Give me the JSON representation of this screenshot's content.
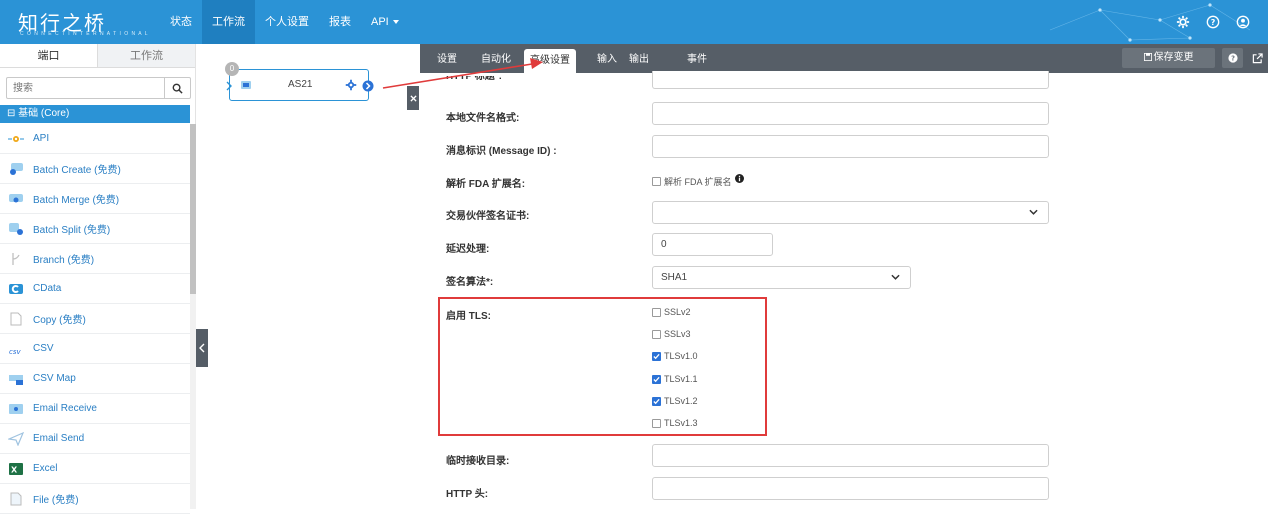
{
  "topbar": {
    "logo": "知行之桥",
    "logo_sub": "C O N N E C T   I N T E R N A T I O N A L",
    "nav": [
      {
        "label": "状态"
      },
      {
        "label": "工作流"
      },
      {
        "label": "个人设置"
      },
      {
        "label": "报表"
      },
      {
        "label": "API"
      }
    ],
    "icons": [
      "gear-icon",
      "help-icon",
      "user-icon"
    ]
  },
  "left": {
    "tabs": [
      {
        "label": "端口"
      },
      {
        "label": "工作流"
      }
    ],
    "search_placeholder": "搜索",
    "category": "⊟ 基础 (Core)",
    "items": [
      {
        "label": "API",
        "icon": "api-icon"
      },
      {
        "label": "Batch Create (免费)",
        "icon": "batch-create-icon"
      },
      {
        "label": "Batch Merge (免费)",
        "icon": "batch-merge-icon"
      },
      {
        "label": "Batch Split (免费)",
        "icon": "batch-split-icon"
      },
      {
        "label": "Branch (免费)",
        "icon": "branch-icon"
      },
      {
        "label": "CData",
        "icon": "cdata-icon"
      },
      {
        "label": "Copy (免费)",
        "icon": "copy-icon"
      },
      {
        "label": "CSV",
        "icon": "csv-icon"
      },
      {
        "label": "CSV Map",
        "icon": "csv-map-icon"
      },
      {
        "label": "Email Receive",
        "icon": "email-receive-icon"
      },
      {
        "label": "Email Send",
        "icon": "email-send-icon"
      },
      {
        "label": "Excel",
        "icon": "excel-icon"
      },
      {
        "label": "File (免费)",
        "icon": "file-icon"
      }
    ]
  },
  "canvas": {
    "node_badge": "0",
    "node_label": "AS21"
  },
  "right": {
    "tabs": [
      {
        "label": "设置"
      },
      {
        "label": "自动化"
      },
      {
        "label": "高级设置"
      },
      {
        "label": "输入"
      },
      {
        "label": "输出"
      },
      {
        "label": "事件"
      }
    ],
    "save_label": "保存变更",
    "fields": {
      "http_subject": "HTTP 标题*:",
      "local_filename": "本地文件名格式:",
      "message_id": "消息标识 (Message ID) :",
      "parse_fda": "解析 FDA 扩展名:",
      "parse_fda_checkbox": "解析 FDA 扩展名",
      "partner_cert": "交易伙伴签名证书:",
      "delay": "延迟处理:",
      "delay_value": "0",
      "sign_algo": "签名算法*:",
      "sign_algo_value": "SHA1",
      "tls": "启用 TLS:",
      "temp_dir": "临时接收目录:",
      "http_header": "HTTP 头:"
    },
    "tls_options": [
      {
        "label": "SSLv2",
        "checked": false
      },
      {
        "label": "SSLv3",
        "checked": false
      },
      {
        "label": "TLSv1.0",
        "checked": true
      },
      {
        "label": "TLSv1.1",
        "checked": true
      },
      {
        "label": "TLSv1.2",
        "checked": true
      },
      {
        "label": "TLSv1.3",
        "checked": false
      }
    ]
  },
  "colors": {
    "brand": "#2b93d6",
    "tabbar": "#565e67",
    "highlight": "#e03b3b",
    "checked": "#2b72d6"
  }
}
